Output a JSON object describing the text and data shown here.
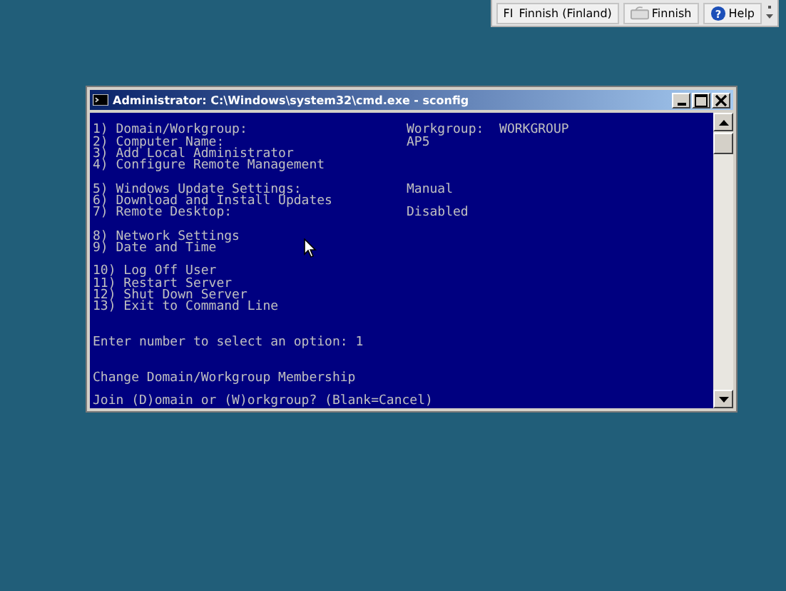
{
  "language_bar": [
    {
      "kind": "language",
      "code": "FI",
      "label": "Finnish (Finland)"
    },
    {
      "kind": "keyboard",
      "label": "Finnish"
    },
    {
      "kind": "help",
      "icon": "?",
      "label": "Help"
    }
  ],
  "window": {
    "title": "Administrator: C:\\Windows\\system32\\cmd.exe - sconfig"
  },
  "console_lines": [
    {
      "kind": "blank"
    },
    {
      "kind": "text",
      "text": "1) Domain/Workgroup:",
      "value": "Workgroup:  WORKGROUP"
    },
    {
      "kind": "text",
      "text": "2) Computer Name:",
      "value": "AP5"
    },
    {
      "kind": "text",
      "text": "3) Add Local Administrator"
    },
    {
      "kind": "text",
      "text": "4) Configure Remote Management"
    },
    {
      "kind": "blank"
    },
    {
      "kind": "text",
      "text": "5) Windows Update Settings:",
      "value": "Manual"
    },
    {
      "kind": "text",
      "text": "6) Download and Install Updates"
    },
    {
      "kind": "text",
      "text": "7) Remote Desktop:",
      "value": "Disabled"
    },
    {
      "kind": "blank"
    },
    {
      "kind": "text",
      "text": "8) Network Settings"
    },
    {
      "kind": "text",
      "text": "9) Date and Time"
    },
    {
      "kind": "blank"
    },
    {
      "kind": "text",
      "text": "10) Log Off User"
    },
    {
      "kind": "text",
      "text": "11) Restart Server"
    },
    {
      "kind": "text",
      "text": "12) Shut Down Server"
    },
    {
      "kind": "text",
      "text": "13) Exit to Command Line"
    },
    {
      "kind": "blank"
    },
    {
      "kind": "blank"
    },
    {
      "kind": "text",
      "text": "Enter number to select an option: 1"
    },
    {
      "kind": "blank"
    },
    {
      "kind": "blank"
    },
    {
      "kind": "text",
      "text": "Change Domain/Workgroup Membership"
    },
    {
      "kind": "blank"
    },
    {
      "kind": "text",
      "text": "Join (D)omain or (W)orkgroup? (Blank=Cancel)"
    }
  ]
}
